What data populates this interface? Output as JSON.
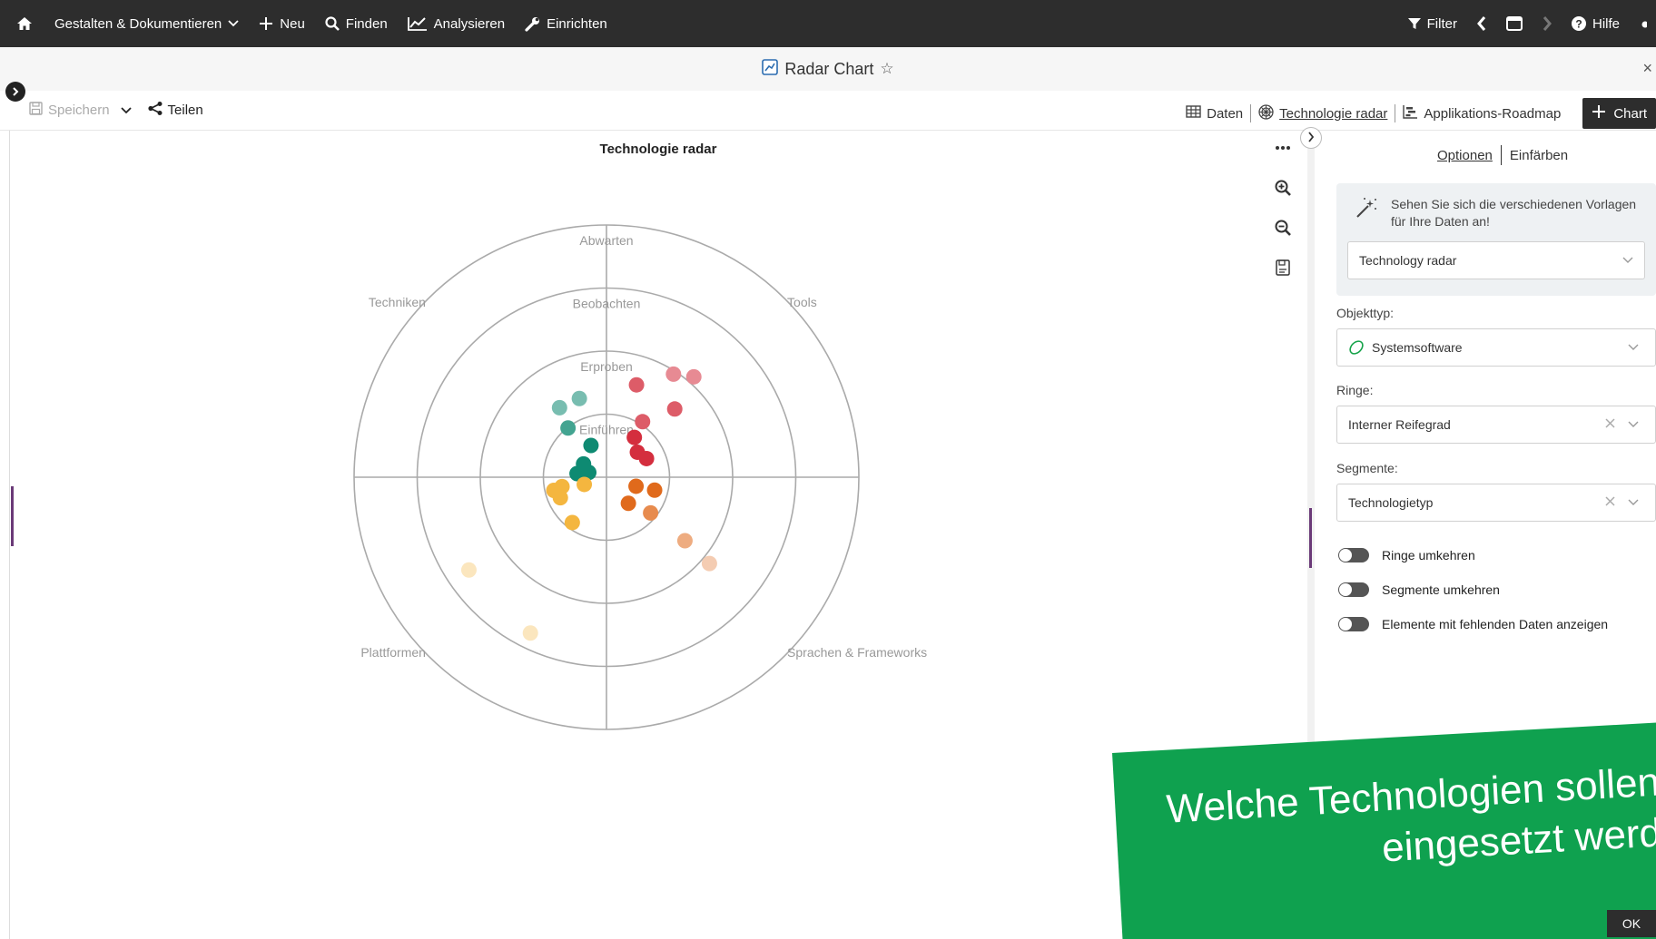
{
  "nav": {
    "items": [
      {
        "name": "home",
        "label": ""
      },
      {
        "name": "gestalten",
        "label": "Gestalten & Dokumentieren"
      },
      {
        "name": "neu",
        "label": "Neu"
      },
      {
        "name": "finden",
        "label": "Finden"
      },
      {
        "name": "analysieren",
        "label": "Analysieren"
      },
      {
        "name": "einrichten",
        "label": "Einrichten"
      }
    ],
    "filter_label": "Filter",
    "help_label": "Hilfe"
  },
  "page": {
    "title": "Radar Chart",
    "star": "☆",
    "close": "×"
  },
  "toolbar": {
    "save_label": "Speichern",
    "share_label": "Teilen",
    "views": [
      {
        "label": "Daten"
      },
      {
        "label": "Technologie radar"
      },
      {
        "label": "Applikations-Roadmap"
      }
    ],
    "add_chart_label": "Chart"
  },
  "chart_tools": [
    "more-icon",
    "zoom-in-icon",
    "zoom-out-icon",
    "export-icon"
  ],
  "panel": {
    "tabs": [
      "Optionen",
      "Einfärben"
    ],
    "template_hint": "Sehen Sie sich die verschiedenen Vorlagen für Ihre Daten an!",
    "template_value": "Technology radar",
    "objecttype_label": "Objekttyp:",
    "objecttype_value": "Systemsoftware",
    "rings_label": "Ringe:",
    "rings_value": "Interner Reifegrad",
    "segments_label": "Segmente:",
    "segments_value": "Technologietyp",
    "toggles": [
      "Ringe umkehren",
      "Segmente umkehren",
      "Elemente mit fehlenden Daten anzeigen"
    ]
  },
  "banner": {
    "line1": "Welche Technologien sollen für",
    "line2": "eingesetzt werd",
    "ok_label": "OK"
  },
  "chart_data": {
    "type": "scatter",
    "title": "Technologie radar",
    "rings": [
      "Einführen",
      "Erproben",
      "Beobachten",
      "Abwarten"
    ],
    "segments": [
      {
        "name": "Techniken",
        "color": "#0e8a72"
      },
      {
        "name": "Tools",
        "color": "#d42e3e"
      },
      {
        "name": "Sprachen & Frameworks",
        "color": "#e06a1c"
      },
      {
        "name": "Plattformen",
        "color": "#f4b63f"
      }
    ],
    "grid": true,
    "points": [
      {
        "segment": "Techniken",
        "ring": "Einführen",
        "angle": 7,
        "r": 0.47
      },
      {
        "segment": "Techniken",
        "ring": "Einführen",
        "angle": 15,
        "r": 0.29
      },
      {
        "segment": "Techniken",
        "ring": "Einführen",
        "angle": 30,
        "r": 0.42
      },
      {
        "segment": "Techniken",
        "ring": "Einführen",
        "angle": 64,
        "r": 0.56
      },
      {
        "segment": "Techniken",
        "ring": "Erproben",
        "angle": 52,
        "r": 0.99
      },
      {
        "segment": "Techniken",
        "ring": "Beobachten",
        "angle": 56,
        "r": 1.33
      },
      {
        "segment": "Techniken",
        "ring": "Beobachten",
        "angle": 71,
        "r": 1.32
      },
      {
        "segment": "Tools",
        "ring": "Einführen",
        "angle": 25,
        "r": 0.7
      },
      {
        "segment": "Tools",
        "ring": "Einführen",
        "angle": 39,
        "r": 0.63
      },
      {
        "segment": "Tools",
        "ring": "Einführen",
        "angle": 55,
        "r": 0.77
      },
      {
        "segment": "Tools",
        "ring": "Erproben",
        "angle": 57,
        "r": 1.05
      },
      {
        "segment": "Tools",
        "ring": "Erproben",
        "angle": 72,
        "r": 1.54
      },
      {
        "segment": "Tools",
        "ring": "Erproben",
        "angle": 45,
        "r": 1.53
      },
      {
        "segment": "Tools",
        "ring": "Beobachten",
        "angle": 57,
        "r": 1.95
      },
      {
        "segment": "Tools",
        "ring": "Beobachten",
        "angle": 49,
        "r": 2.11
      },
      {
        "segment": "Sprachen & Frameworks",
        "ring": "Einführen",
        "angle": 17,
        "r": 0.49
      },
      {
        "segment": "Sprachen & Frameworks",
        "ring": "Einführen",
        "angle": 50,
        "r": 0.54
      },
      {
        "segment": "Sprachen & Frameworks",
        "ring": "Einführen",
        "angle": 15,
        "r": 0.79
      },
      {
        "segment": "Sprachen & Frameworks",
        "ring": "Erproben",
        "angle": 39,
        "r": 0.9
      },
      {
        "segment": "Sprachen & Frameworks",
        "ring": "Beobachten",
        "angle": 39,
        "r": 1.6
      },
      {
        "segment": "Sprachen & Frameworks",
        "ring": "Abwarten",
        "angle": 40,
        "r": 2.13
      },
      {
        "segment": "Plattformen",
        "ring": "Einführen",
        "angle": 12,
        "r": 0.72
      },
      {
        "segment": "Plattformen",
        "ring": "Einführen",
        "angle": 24,
        "r": 0.8
      },
      {
        "segment": "Plattformen",
        "ring": "Einführen",
        "angle": 53,
        "r": 0.9
      },
      {
        "segment": "Plattformen",
        "ring": "Einführen",
        "angle": 14,
        "r": 0.86
      },
      {
        "segment": "Plattformen",
        "ring": "Einführen",
        "angle": 18,
        "r": 0.37
      },
      {
        "segment": "Plattformen",
        "ring": "Abwarten",
        "angle": 34,
        "r": 2.63
      },
      {
        "segment": "Plattformen",
        "ring": "Abwarten",
        "angle": 64,
        "r": 2.75
      }
    ]
  }
}
